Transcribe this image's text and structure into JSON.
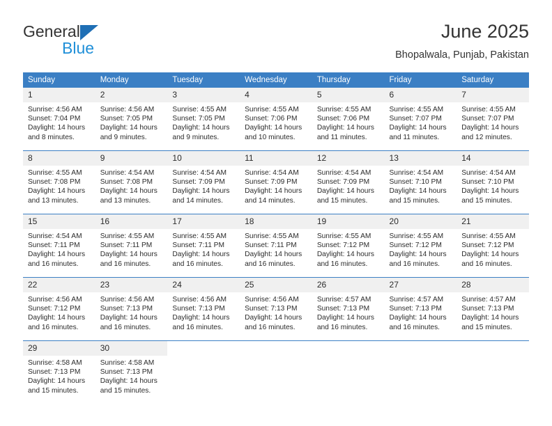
{
  "brand": {
    "word1": "General",
    "word2": "Blue",
    "triangle_color": "#1f6fb5",
    "blue_color": "#1f8fd8"
  },
  "header": {
    "title": "June 2025",
    "location": "Bhopalwala, Punjab, Pakistan"
  },
  "theme": {
    "header_blue": "#3b7fc4",
    "daynum_gray": "#f0f0f0",
    "text": "#2b2b2b"
  },
  "weekdays": [
    "Sunday",
    "Monday",
    "Tuesday",
    "Wednesday",
    "Thursday",
    "Friday",
    "Saturday"
  ],
  "weeks": [
    [
      {
        "day": "1",
        "sunrise": "Sunrise: 4:56 AM",
        "sunset": "Sunset: 7:04 PM",
        "daylight1": "Daylight: 14 hours",
        "daylight2": "and 8 minutes."
      },
      {
        "day": "2",
        "sunrise": "Sunrise: 4:56 AM",
        "sunset": "Sunset: 7:05 PM",
        "daylight1": "Daylight: 14 hours",
        "daylight2": "and 9 minutes."
      },
      {
        "day": "3",
        "sunrise": "Sunrise: 4:55 AM",
        "sunset": "Sunset: 7:05 PM",
        "daylight1": "Daylight: 14 hours",
        "daylight2": "and 9 minutes."
      },
      {
        "day": "4",
        "sunrise": "Sunrise: 4:55 AM",
        "sunset": "Sunset: 7:06 PM",
        "daylight1": "Daylight: 14 hours",
        "daylight2": "and 10 minutes."
      },
      {
        "day": "5",
        "sunrise": "Sunrise: 4:55 AM",
        "sunset": "Sunset: 7:06 PM",
        "daylight1": "Daylight: 14 hours",
        "daylight2": "and 11 minutes."
      },
      {
        "day": "6",
        "sunrise": "Sunrise: 4:55 AM",
        "sunset": "Sunset: 7:07 PM",
        "daylight1": "Daylight: 14 hours",
        "daylight2": "and 11 minutes."
      },
      {
        "day": "7",
        "sunrise": "Sunrise: 4:55 AM",
        "sunset": "Sunset: 7:07 PM",
        "daylight1": "Daylight: 14 hours",
        "daylight2": "and 12 minutes."
      }
    ],
    [
      {
        "day": "8",
        "sunrise": "Sunrise: 4:55 AM",
        "sunset": "Sunset: 7:08 PM",
        "daylight1": "Daylight: 14 hours",
        "daylight2": "and 13 minutes."
      },
      {
        "day": "9",
        "sunrise": "Sunrise: 4:54 AM",
        "sunset": "Sunset: 7:08 PM",
        "daylight1": "Daylight: 14 hours",
        "daylight2": "and 13 minutes."
      },
      {
        "day": "10",
        "sunrise": "Sunrise: 4:54 AM",
        "sunset": "Sunset: 7:09 PM",
        "daylight1": "Daylight: 14 hours",
        "daylight2": "and 14 minutes."
      },
      {
        "day": "11",
        "sunrise": "Sunrise: 4:54 AM",
        "sunset": "Sunset: 7:09 PM",
        "daylight1": "Daylight: 14 hours",
        "daylight2": "and 14 minutes."
      },
      {
        "day": "12",
        "sunrise": "Sunrise: 4:54 AM",
        "sunset": "Sunset: 7:09 PM",
        "daylight1": "Daylight: 14 hours",
        "daylight2": "and 15 minutes."
      },
      {
        "day": "13",
        "sunrise": "Sunrise: 4:54 AM",
        "sunset": "Sunset: 7:10 PM",
        "daylight1": "Daylight: 14 hours",
        "daylight2": "and 15 minutes."
      },
      {
        "day": "14",
        "sunrise": "Sunrise: 4:54 AM",
        "sunset": "Sunset: 7:10 PM",
        "daylight1": "Daylight: 14 hours",
        "daylight2": "and 15 minutes."
      }
    ],
    [
      {
        "day": "15",
        "sunrise": "Sunrise: 4:54 AM",
        "sunset": "Sunset: 7:11 PM",
        "daylight1": "Daylight: 14 hours",
        "daylight2": "and 16 minutes."
      },
      {
        "day": "16",
        "sunrise": "Sunrise: 4:55 AM",
        "sunset": "Sunset: 7:11 PM",
        "daylight1": "Daylight: 14 hours",
        "daylight2": "and 16 minutes."
      },
      {
        "day": "17",
        "sunrise": "Sunrise: 4:55 AM",
        "sunset": "Sunset: 7:11 PM",
        "daylight1": "Daylight: 14 hours",
        "daylight2": "and 16 minutes."
      },
      {
        "day": "18",
        "sunrise": "Sunrise: 4:55 AM",
        "sunset": "Sunset: 7:11 PM",
        "daylight1": "Daylight: 14 hours",
        "daylight2": "and 16 minutes."
      },
      {
        "day": "19",
        "sunrise": "Sunrise: 4:55 AM",
        "sunset": "Sunset: 7:12 PM",
        "daylight1": "Daylight: 14 hours",
        "daylight2": "and 16 minutes."
      },
      {
        "day": "20",
        "sunrise": "Sunrise: 4:55 AM",
        "sunset": "Sunset: 7:12 PM",
        "daylight1": "Daylight: 14 hours",
        "daylight2": "and 16 minutes."
      },
      {
        "day": "21",
        "sunrise": "Sunrise: 4:55 AM",
        "sunset": "Sunset: 7:12 PM",
        "daylight1": "Daylight: 14 hours",
        "daylight2": "and 16 minutes."
      }
    ],
    [
      {
        "day": "22",
        "sunrise": "Sunrise: 4:56 AM",
        "sunset": "Sunset: 7:12 PM",
        "daylight1": "Daylight: 14 hours",
        "daylight2": "and 16 minutes."
      },
      {
        "day": "23",
        "sunrise": "Sunrise: 4:56 AM",
        "sunset": "Sunset: 7:13 PM",
        "daylight1": "Daylight: 14 hours",
        "daylight2": "and 16 minutes."
      },
      {
        "day": "24",
        "sunrise": "Sunrise: 4:56 AM",
        "sunset": "Sunset: 7:13 PM",
        "daylight1": "Daylight: 14 hours",
        "daylight2": "and 16 minutes."
      },
      {
        "day": "25",
        "sunrise": "Sunrise: 4:56 AM",
        "sunset": "Sunset: 7:13 PM",
        "daylight1": "Daylight: 14 hours",
        "daylight2": "and 16 minutes."
      },
      {
        "day": "26",
        "sunrise": "Sunrise: 4:57 AM",
        "sunset": "Sunset: 7:13 PM",
        "daylight1": "Daylight: 14 hours",
        "daylight2": "and 16 minutes."
      },
      {
        "day": "27",
        "sunrise": "Sunrise: 4:57 AM",
        "sunset": "Sunset: 7:13 PM",
        "daylight1": "Daylight: 14 hours",
        "daylight2": "and 16 minutes."
      },
      {
        "day": "28",
        "sunrise": "Sunrise: 4:57 AM",
        "sunset": "Sunset: 7:13 PM",
        "daylight1": "Daylight: 14 hours",
        "daylight2": "and 15 minutes."
      }
    ],
    [
      {
        "day": "29",
        "sunrise": "Sunrise: 4:58 AM",
        "sunset": "Sunset: 7:13 PM",
        "daylight1": "Daylight: 14 hours",
        "daylight2": "and 15 minutes."
      },
      {
        "day": "30",
        "sunrise": "Sunrise: 4:58 AM",
        "sunset": "Sunset: 7:13 PM",
        "daylight1": "Daylight: 14 hours",
        "daylight2": "and 15 minutes."
      },
      null,
      null,
      null,
      null,
      null
    ]
  ]
}
